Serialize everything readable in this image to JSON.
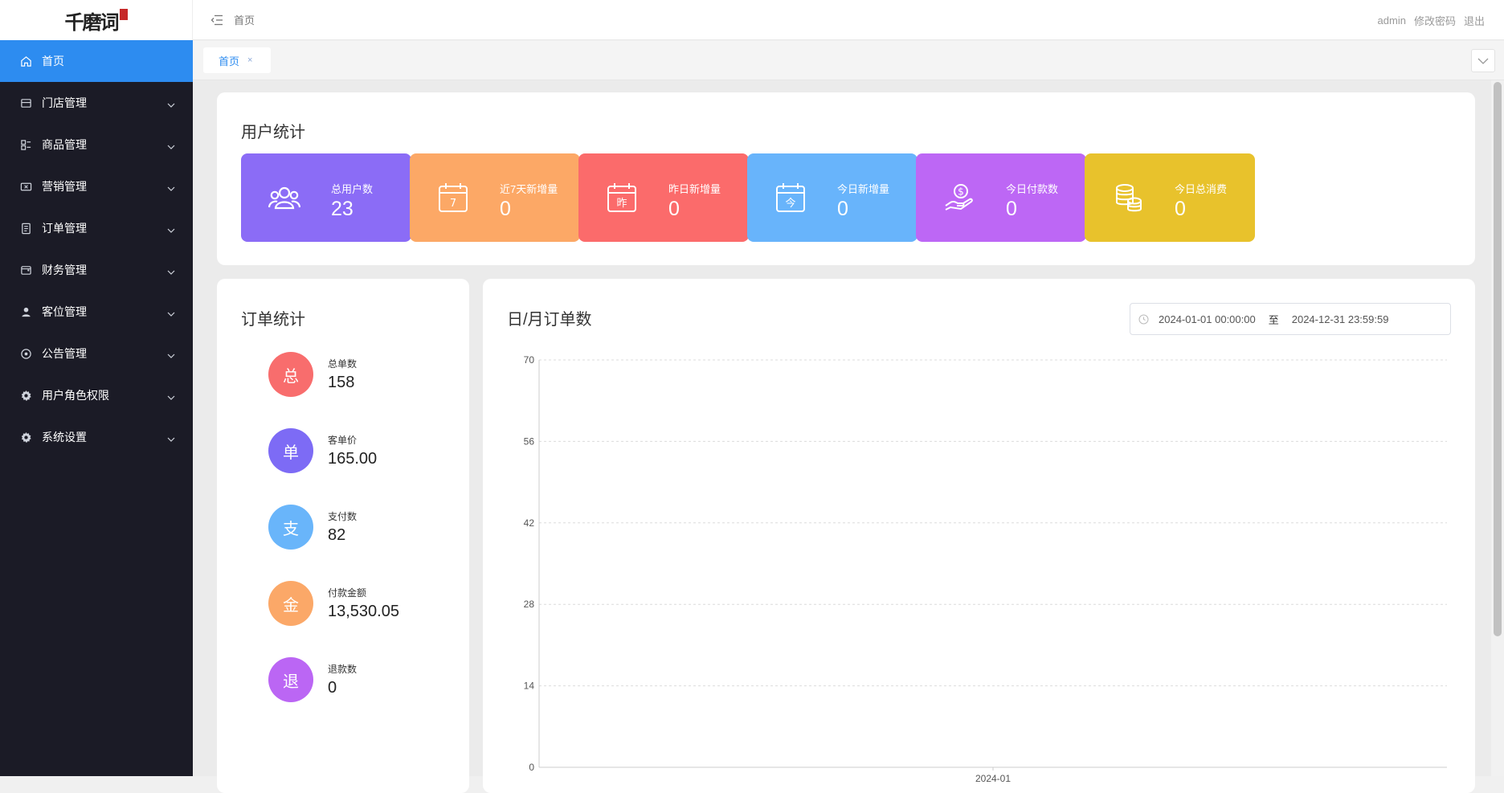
{
  "sidebar": {
    "logo_text": "千磨词",
    "items": [
      {
        "label": "首页",
        "icon": "home-icon",
        "active": true,
        "expandable": false
      },
      {
        "label": "门店管理",
        "icon": "store-icon",
        "active": false,
        "expandable": true
      },
      {
        "label": "商品管理",
        "icon": "goods-icon",
        "active": false,
        "expandable": true
      },
      {
        "label": "营销管理",
        "icon": "ticket-icon",
        "active": false,
        "expandable": true
      },
      {
        "label": "订单管理",
        "icon": "document-icon",
        "active": false,
        "expandable": true
      },
      {
        "label": "财务管理",
        "icon": "wallet-icon",
        "active": false,
        "expandable": true
      },
      {
        "label": "客位管理",
        "icon": "person-icon",
        "active": false,
        "expandable": true
      },
      {
        "label": "公告管理",
        "icon": "compass-icon",
        "active": false,
        "expandable": true
      },
      {
        "label": "用户角色权限",
        "icon": "gear-icon",
        "active": false,
        "expandable": true
      },
      {
        "label": "系统设置",
        "icon": "gear-icon",
        "active": false,
        "expandable": true
      }
    ]
  },
  "header": {
    "breadcrumb": "首页",
    "user": "admin",
    "change_password": "修改密码",
    "logout": "退出"
  },
  "tabs": [
    {
      "label": "首页",
      "close": "×"
    }
  ],
  "user_stats": {
    "title": "用户统计",
    "cards": [
      {
        "label": "总用户数",
        "value": "23",
        "color": "#8b6cf6",
        "icon": "users-icon"
      },
      {
        "label": "近7天新增量",
        "value": "0",
        "color": "#fca866",
        "icon": "calendar-7-icon",
        "glyph": "7"
      },
      {
        "label": "昨日新增量",
        "value": "0",
        "color": "#fb6b6b",
        "icon": "calendar-yesterday-icon",
        "glyph": "昨"
      },
      {
        "label": "今日新增量",
        "value": "0",
        "color": "#68b4fb",
        "icon": "calendar-today-icon",
        "glyph": "今"
      },
      {
        "label": "今日付款数",
        "value": "0",
        "color": "#bd67f5",
        "icon": "money-hand-icon"
      },
      {
        "label": "今日总消费",
        "value": "0",
        "color": "#e8c22c",
        "icon": "coins-icon"
      }
    ]
  },
  "order_stats": {
    "title": "订单统计",
    "items": [
      {
        "glyph": "总",
        "label": "总单数",
        "value": "158",
        "color": "#f86d6d"
      },
      {
        "glyph": "单",
        "label": "客单价",
        "value": "165.00",
        "color": "#7d6bf5"
      },
      {
        "glyph": "支",
        "label": "支付数",
        "value": "82",
        "color": "#69b5fa"
      },
      {
        "glyph": "金",
        "label": "付款金额",
        "value": "13,530.05",
        "color": "#fba868"
      },
      {
        "glyph": "退",
        "label": "退款数",
        "value": "0",
        "color": "#bb66f4"
      }
    ]
  },
  "order_chart": {
    "title": "日/月订单数",
    "date_start": "2024-01-01 00:00:00",
    "date_separator": "至",
    "date_end": "2024-12-31 23:59:59"
  },
  "chart_data": {
    "type": "line",
    "title": "日/月订单数",
    "x": [
      "2024-01"
    ],
    "series": [],
    "xlabel": "",
    "ylabel": "",
    "ylim": [
      0,
      70
    ],
    "yticks": [
      0,
      14,
      28,
      42,
      56,
      70
    ],
    "grid": true
  }
}
